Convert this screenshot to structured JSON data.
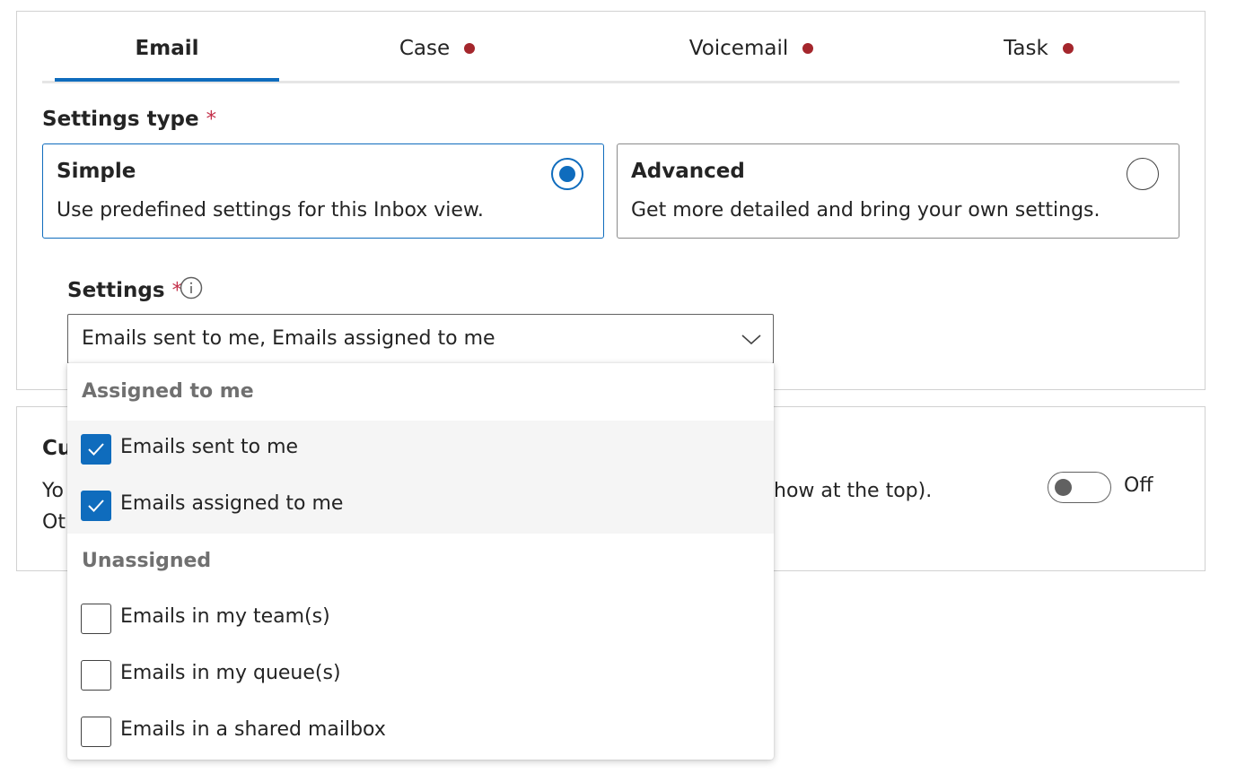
{
  "tabs": [
    {
      "label": "Email",
      "active": true,
      "dot": false
    },
    {
      "label": "Case",
      "active": false,
      "dot": true
    },
    {
      "label": "Voicemail",
      "active": false,
      "dot": true
    },
    {
      "label": "Task",
      "active": false,
      "dot": true
    }
  ],
  "colors": {
    "accent": "#0f6cbd",
    "required": "#c4314b",
    "tab_dot": "#a4262c"
  },
  "settings_type": {
    "label": "Settings type",
    "required_mark": "*",
    "options": [
      {
        "title": "Simple",
        "description": "Use predefined settings for this Inbox view.",
        "selected": true
      },
      {
        "title": "Advanced",
        "description": "Get more detailed and bring your own settings.",
        "selected": false
      }
    ]
  },
  "settings": {
    "label": "Settings",
    "required_mark": "*",
    "info_icon": "info-icon",
    "selected_value": "Emails sent to me, Emails assigned to me",
    "chevron_icon": "chevron-down-icon"
  },
  "dropdown_menu": {
    "groups": [
      {
        "header": "Assigned to me",
        "items": [
          {
            "label": "Emails sent to me",
            "checked": true
          },
          {
            "label": "Emails assigned to me",
            "checked": true
          }
        ]
      },
      {
        "header": "Unassigned",
        "items": [
          {
            "label": "Emails in my team(s)",
            "checked": false
          },
          {
            "label": "Emails in my queue(s)",
            "checked": false
          },
          {
            "label": "Emails in a shared mailbox",
            "checked": false
          }
        ]
      }
    ]
  },
  "background_section": {
    "title_fragment": "Cu",
    "line1_start": "Yo",
    "line1_end": "how at the top).",
    "line2_start": "Ot",
    "toggle_state": "Off"
  }
}
